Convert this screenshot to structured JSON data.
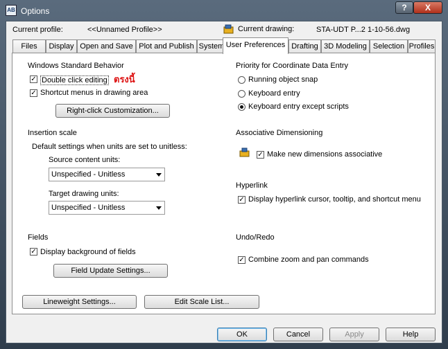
{
  "window": {
    "title": "Options",
    "help_glyph": "?",
    "close_glyph": "X",
    "icon_text": "AB"
  },
  "header": {
    "current_profile_label": "Current profile:",
    "current_profile_value": "<<Unnamed Profile>>",
    "current_drawing_label": "Current drawing:",
    "current_drawing_value": "STA-UDT P...2 1-10-56.dwg"
  },
  "tabs": [
    {
      "label": "Files"
    },
    {
      "label": "Display"
    },
    {
      "label": "Open and Save"
    },
    {
      "label": "Plot and Publish"
    },
    {
      "label": "System"
    },
    {
      "label": "User Preferences"
    },
    {
      "label": "Drafting"
    },
    {
      "label": "3D Modeling"
    },
    {
      "label": "Selection"
    },
    {
      "label": "Profiles"
    }
  ],
  "active_tab": "User Preferences",
  "windows_behavior": {
    "heading": "Windows Standard Behavior",
    "double_click": "Double click editing",
    "double_click_checked": true,
    "annotation": "ตรงนี้",
    "shortcut_menus": "Shortcut menus in drawing area",
    "shortcut_menus_checked": true,
    "right_click_button": "Right-click Customization..."
  },
  "insertion_scale": {
    "heading": "Insertion scale",
    "description": "Default settings when units are set to unitless:",
    "source_label": "Source content units:",
    "source_value": "Unspecified - Unitless",
    "target_label": "Target drawing units:",
    "target_value": "Unspecified - Unitless"
  },
  "fields": {
    "heading": "Fields",
    "display_background": "Display background of fields",
    "display_background_checked": true,
    "update_button": "Field Update Settings..."
  },
  "bottom_buttons": {
    "lineweight": "Lineweight Settings...",
    "scale_list": "Edit Scale List..."
  },
  "priority": {
    "heading": "Priority for Coordinate Data Entry",
    "options": [
      "Running object snap",
      "Keyboard entry",
      "Keyboard entry except scripts"
    ],
    "selected_index": 2
  },
  "assoc_dim": {
    "heading": "Associative Dimensioning",
    "label": "Make new dimensions associative",
    "checked": true
  },
  "hyperlink": {
    "heading": "Hyperlink",
    "label": "Display hyperlink cursor, tooltip, and shortcut menu",
    "checked": true
  },
  "undo_redo": {
    "heading": "Undo/Redo",
    "label": "Combine zoom and pan commands",
    "checked": true
  },
  "dialog_buttons": {
    "ok": "OK",
    "cancel": "Cancel",
    "apply": "Apply",
    "help": "Help"
  },
  "check_glyph": "✓"
}
